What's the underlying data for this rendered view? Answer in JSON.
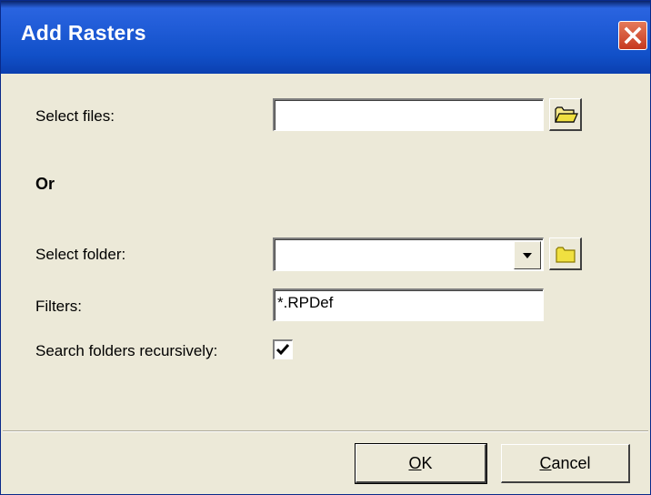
{
  "window": {
    "title": "Add Rasters"
  },
  "select_files": {
    "label": "Select files:",
    "value": ""
  },
  "or_label": "Or",
  "select_folder": {
    "label": "Select folder:",
    "value": ""
  },
  "filters": {
    "label": "Filters:",
    "value": "*.RPDef"
  },
  "recursive": {
    "label": "Search folders recursively:",
    "checked": true
  },
  "buttons": {
    "ok": {
      "mnemonic": "O",
      "rest": "K"
    },
    "cancel": {
      "mnemonic": "C",
      "rest": "ancel"
    }
  },
  "icons": {
    "close": "close-icon",
    "open_folder": "open-folder-icon",
    "folder": "folder-icon",
    "dropdown": "chevron-down-icon",
    "check": "checkmark-icon"
  },
  "colors": {
    "title_bar": "#1f5bd6",
    "dialog_bg": "#ece9d8",
    "close_button": "#d2492c",
    "folder_yellow": "#f0e040"
  }
}
